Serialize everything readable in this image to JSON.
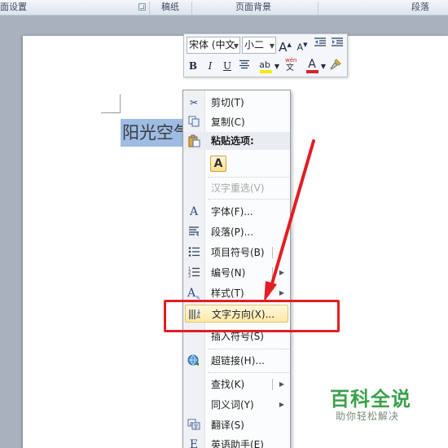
{
  "ribbon": {
    "groups": [
      "面设置",
      "稿纸",
      "页面背景",
      "段落"
    ]
  },
  "document": {
    "selected_text": "阳光空气"
  },
  "mini_toolbar": {
    "font": "宋体 (中文",
    "size": "小二",
    "grow_font_glyph": "A",
    "shrink_font_glyph": "A",
    "bold": "B",
    "italic": "I",
    "underline": "U",
    "highlight_glyph": "ab",
    "font_color_glyph": "A",
    "highlight_color": "#f7e90b",
    "font_color": "#d8232a"
  },
  "context_menu": {
    "items": [
      {
        "label": "剪切(T)",
        "icon": "scissors-icon"
      },
      {
        "label": "复制(C)",
        "icon": "copy-icon"
      },
      {
        "label": "粘贴选项:",
        "icon": "paste-icon"
      },
      {
        "label": "A",
        "icon": "keep-text-only-icon"
      },
      {
        "label": "汉字重选(V)",
        "icon": ""
      },
      {
        "label": "字体(F)...",
        "icon": "font-icon"
      },
      {
        "label": "段落(P)...",
        "icon": "paragraph-icon"
      },
      {
        "label": "项目符号(B)",
        "icon": "bullets-icon"
      },
      {
        "label": "编号(N)",
        "icon": "numbering-icon"
      },
      {
        "label": "样式(T)",
        "icon": "styles-icon"
      },
      {
        "label": "文字方向(X)...",
        "icon": "text-direction-icon"
      },
      {
        "label": "插入符号(S)",
        "icon": ""
      },
      {
        "label": "超链接(H)...",
        "icon": "hyperlink-icon"
      },
      {
        "label": "查找(K)",
        "icon": ""
      },
      {
        "label": "同义词(Y)",
        "icon": ""
      },
      {
        "label": "翻译(S)",
        "icon": "translate-icon"
      },
      {
        "label": "英语助手(E)",
        "icon": "english-assistant-icon"
      }
    ],
    "highlight_color": "#e21e24"
  },
  "watermark": {
    "title": "百科全说",
    "subtitle": "助你轻松解决"
  }
}
